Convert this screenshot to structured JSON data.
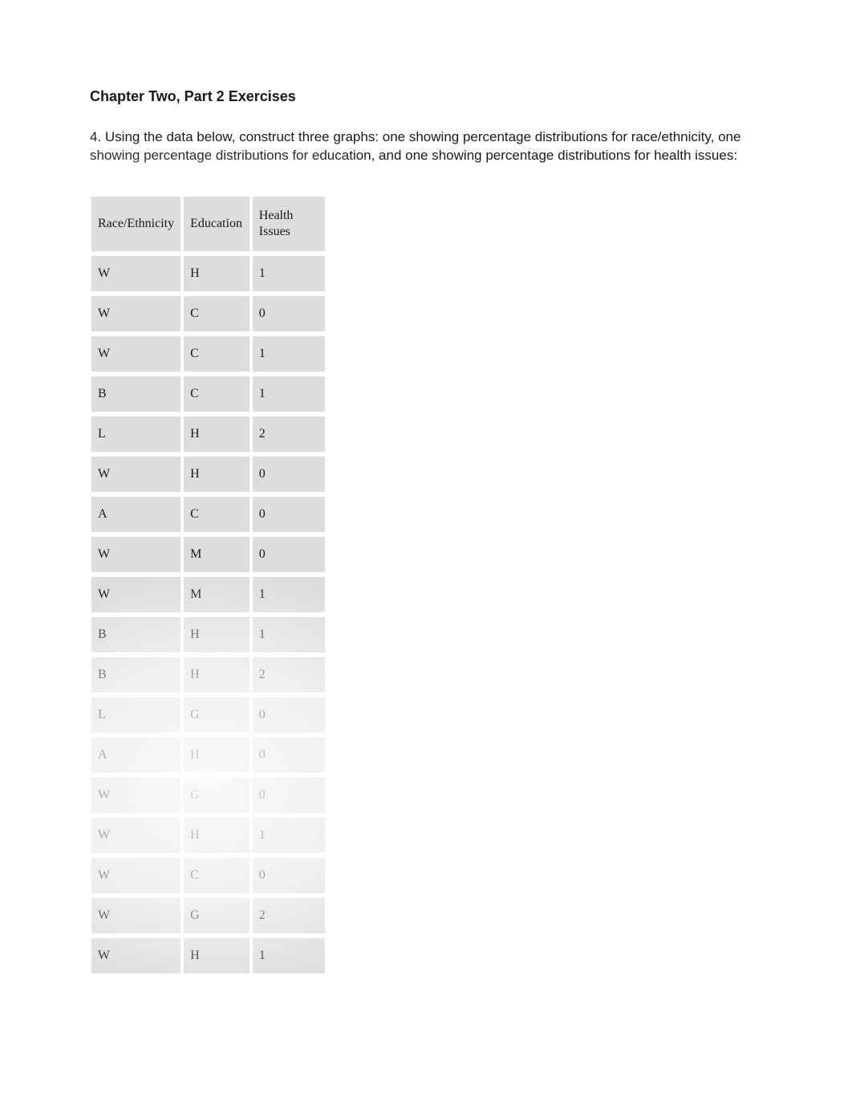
{
  "heading": "Chapter Two, Part 2 Exercises",
  "prompt": "4. Using the data below, construct three graphs: one showing percentage distributions for race/ethnicity, one showing percentage distributions for education, and one showing percentage distributions for health issues:",
  "table": {
    "headers": {
      "race": "Race/Ethnicity",
      "education": "Education",
      "health": "Health Issues"
    },
    "rows": [
      {
        "race": "W",
        "education": "H",
        "health": "1"
      },
      {
        "race": "W",
        "education": "C",
        "health": "0"
      },
      {
        "race": "W",
        "education": "C",
        "health": "1"
      },
      {
        "race": "B",
        "education": "C",
        "health": "1"
      },
      {
        "race": "L",
        "education": "H",
        "health": "2"
      },
      {
        "race": "W",
        "education": "H",
        "health": "0"
      },
      {
        "race": "A",
        "education": "C",
        "health": "0"
      },
      {
        "race": "W",
        "education": "M",
        "health": "0"
      },
      {
        "race": "W",
        "education": "M",
        "health": "1"
      },
      {
        "race": "B",
        "education": "H",
        "health": "1"
      },
      {
        "race": "B",
        "education": "H",
        "health": "2"
      },
      {
        "race": "L",
        "education": "G",
        "health": "0"
      },
      {
        "race": "A",
        "education": "H",
        "health": "0"
      },
      {
        "race": "W",
        "education": "G",
        "health": "0"
      },
      {
        "race": "W",
        "education": "H",
        "health": "1"
      },
      {
        "race": "W",
        "education": "C",
        "health": "0"
      },
      {
        "race": "W",
        "education": "G",
        "health": "2"
      },
      {
        "race": "W",
        "education": "H",
        "health": "1"
      }
    ]
  }
}
